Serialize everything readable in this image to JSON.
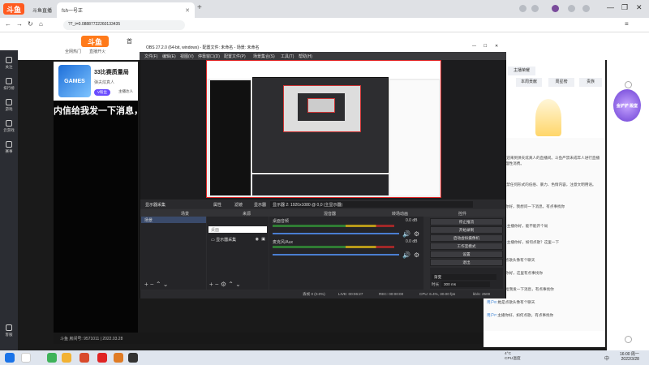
{
  "browser": {
    "brand": "斗鱼",
    "tabs": [
      {
        "label": "斗鱼直播",
        "active": false
      },
      {
        "label": "fsh一号正",
        "active": true
      }
    ],
    "url": "?7_t=0.08887722260133435",
    "window_controls": {
      "minimize": "—",
      "restore": "❐",
      "close": "✕"
    }
  },
  "site": {
    "logo": "斗鱼",
    "nav_first": "全网热门",
    "nav_second": "直播开火",
    "nav_home": "首",
    "left_rail": [
      "关注",
      "排行榜",
      "游戏",
      "云游戏",
      "赛事",
      "客服"
    ]
  },
  "room": {
    "avatar_text": "GAMES",
    "title": "33比赛质量局",
    "streamer": "弹夫炫真人",
    "badge": "V粉丝",
    "level": "主播达人"
  },
  "player": {
    "danmaku": "内信给我发一下消息，",
    "footer": "斗鱼 房间号: 9571011 | 2022.03.28"
  },
  "obs": {
    "title": "OBS 27.2.0 (64-bit, windows) - 配置文件: 未命名 - 场景: 未命名",
    "menu": [
      "文件(F)",
      "编辑(E)",
      "视图(V)",
      "停靠窗口(D)",
      "配置文件(P)",
      "场景集合(S)",
      "工具(T)",
      "帮助(H)"
    ],
    "toolbar": {
      "source_name": "显示器采集",
      "properties": "属性",
      "filters": "滤镜",
      "display_label": "显示器",
      "display_value": "显示器 2: 1920x1080 @ 0,0 (主显示器)"
    },
    "panels": {
      "scenes": "场景",
      "sources": "来源",
      "mixer": "混音器",
      "transitions": "转场动画",
      "controls": "控件"
    },
    "scenes": [
      "场景"
    ],
    "sources": [
      "桌面",
      "显示器采集"
    ],
    "mixer": [
      {
        "name": "桌面音频",
        "db": "0.0 dB"
      },
      {
        "name": "麦克风/Aux",
        "db": "0.0 dB"
      }
    ],
    "controls": [
      "停止推流",
      "开始录制",
      "启动虚拟摄像机",
      "工作室模式",
      "设置",
      "退出"
    ],
    "transitions": {
      "type": "渐变",
      "duration_label": "时长",
      "duration": "300 ms"
    },
    "status": {
      "dropped": "丢帧 0 (0.0%)",
      "live": "LIVE: 00:06:27",
      "rec": "REC: 00:00:00",
      "cpu": "CPU: 6.4%, 30.00 fps",
      "bitrate": "kb/s: 2500"
    }
  },
  "chat": {
    "tabs": [
      "主播荣耀",
      "本周贡献",
      "周星榜",
      "贵族"
    ],
    "lines": [
      {
        "name": "系统提示:",
        "text": "欢迎来到弹夫炫真人的直播间。斗鱼严禁未成年人进行直播或打赏，请理性消费。"
      },
      {
        "name": "系统提示:",
        "text": "严禁任何形式的低俗、暴力、色情内容，注意文明用语。"
      },
      {
        "name": "用户A:",
        "text": "主播你好，我想问一下消息，有点事找你"
      },
      {
        "name": "Jaes不吃鸡:",
        "text": "主播你好，能不能开个局"
      },
      {
        "name": "Jaes不吃鸡:",
        "text": "主播你好，如何点歌？这里一下"
      },
      {
        "name": "用户B:",
        "text": "她是点歌头像有个聊天"
      },
      {
        "name": "用户C:",
        "text": "主播你好，这里有点事找你"
      },
      {
        "name": "用户D:",
        "text": "内信给我发一下消息，有点事找你"
      },
      {
        "name": "用户E:",
        "text": "她是点歌头像有个聊天"
      },
      {
        "name": "用户F:",
        "text": "主播你好，如何点歌，有点事找你"
      }
    ]
  },
  "ad": {
    "label": "金铲铲 殿堂"
  },
  "taskbar": {
    "weather_temp": "4°C",
    "weather_text": "CPU温度",
    "lang": "中",
    "time": "16:00 周一",
    "date": "2022/3/28"
  },
  "colors": {
    "accent": "#ff5a1f",
    "obs_bg": "#2d2d30",
    "rec_border": "#e02424"
  }
}
